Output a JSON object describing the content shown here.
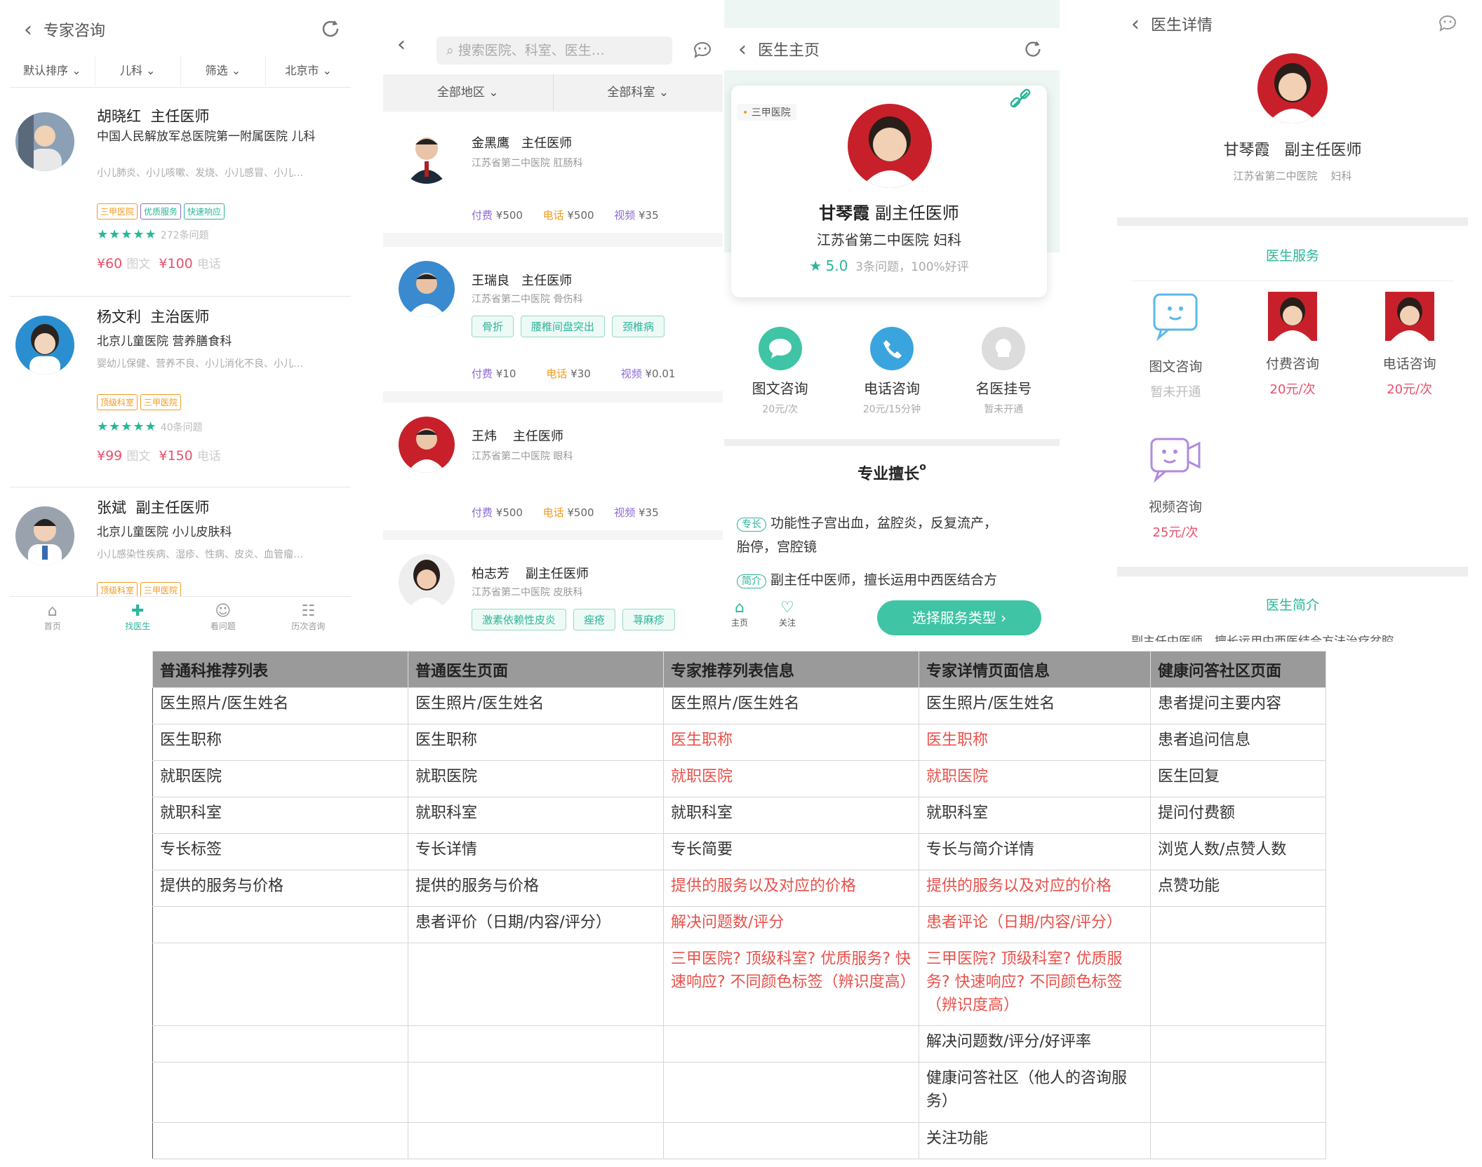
{
  "p1": {
    "title": "专家咨询",
    "filters": [
      "默认排序",
      "儿科",
      "筛选",
      "北京市"
    ],
    "doctors": [
      {
        "name": "胡晓红",
        "rank": "主任医师",
        "hospital": "中国人民解放军总医院第一附属医院 儿科",
        "skills": "小儿肺炎、小儿咳嗽、发烧、小儿感冒、小儿…",
        "tags": [
          "三甲医院",
          "优质服务",
          "快速响应"
        ],
        "count": "272条问题",
        "p1": "¥60",
        "l1": "图文",
        "p2": "¥100",
        "l2": "电话"
      },
      {
        "name": "杨文利",
        "rank": "主治医师",
        "hospital": "北京儿童医院 营养膳食科",
        "skills": "婴幼儿保健、营养不良、小儿消化不良、小儿…",
        "tags": [
          "顶级科室",
          "三甲医院"
        ],
        "count": "40条问题",
        "p1": "¥99",
        "l1": "图文",
        "p2": "¥150",
        "l2": "电话"
      },
      {
        "name": "张斌",
        "rank": "副主任医师",
        "hospital": "北京儿童医院 小儿皮肤科",
        "skills": "小儿感染性疾病、湿疹、性病、皮炎、血管瘤…",
        "tags": [
          "顶级科室",
          "三甲医院"
        ]
      }
    ],
    "nav": [
      "首页",
      "找医生",
      "看问题",
      "历次咨询"
    ]
  },
  "p2": {
    "search": "搜索医院、科室、医生…",
    "filters": [
      "全部地区",
      "全部科室"
    ],
    "doctors": [
      {
        "name": "金黑鹰",
        "rank": "主任医师",
        "hospital": "江苏省第二中医院 肛肠科",
        "pills": [],
        "fee": "¥500",
        "tel": "¥500",
        "video": "¥35"
      },
      {
        "name": "王瑞良",
        "rank": "主任医师",
        "hospital": "江苏省第二中医院 骨伤科",
        "pills": [
          "骨折",
          "腰椎间盘突出",
          "颈椎病"
        ],
        "fee": "¥10",
        "tel": "¥30",
        "video": "¥0.01"
      },
      {
        "name": "王炜",
        "rank": "主任医师",
        "hospital": "江苏省第二中医院 眼科",
        "pills": [],
        "fee": "¥500",
        "tel": "¥500",
        "video": "¥35"
      },
      {
        "name": "柏志芳",
        "rank": "副主任医师",
        "hospital": "江苏省第二中医院 皮肤科",
        "pills": [
          "激素依赖性皮炎",
          "痤疮",
          "荨麻疹"
        ]
      }
    ],
    "fee_label": "付费",
    "tel_label": "电话",
    "video_label": "视频"
  },
  "p3": {
    "title": "医生主页",
    "badge": "三甲医院",
    "name": "甘琴霞",
    "rank": "副主任医师",
    "hospital": "江苏省第二中医院 妇科",
    "score": "5.0",
    "stats": "3条问题，100%好评",
    "services": [
      {
        "name": "图文咨询",
        "price": "20元/次"
      },
      {
        "name": "电话咨询",
        "price": "20元/15分钟"
      },
      {
        "name": "名医挂号",
        "price": "暂未开通"
      }
    ],
    "section": "专业擅长",
    "spec_tag": "专长",
    "spec": "功能性子宫出血，盆腔炎，反复流产，",
    "spec2": "胎停，宫腔镜",
    "intro_tag": "简介",
    "intro": "副主任中医师，擅长运用中西医结合方",
    "nav": [
      "主页",
      "关注"
    ],
    "cta": "选择服务类型"
  },
  "p4": {
    "title": "医生详情",
    "name": "甘琴霞",
    "rank": "副主任医师",
    "hospital": "江苏省第二中医院",
    "dept": "妇科",
    "section1": "医生服务",
    "services": [
      {
        "name": "图文咨询",
        "price": "暂未开通"
      },
      {
        "name": "付费咨询",
        "price": "20元/次"
      },
      {
        "name": "电话咨询",
        "price": "20元/次"
      },
      {
        "name": "视频咨询",
        "price": "25元/次"
      }
    ],
    "section2": "医生简介",
    "intro": "副主任中医师，擅长运用中西医结合方法治疗盆腔"
  },
  "table": {
    "headers": [
      "普通科推荐列表",
      "普通医生页面",
      "专家推荐列表信息",
      "专家详情页面信息",
      "健康问答社区页面"
    ],
    "rows": [
      [
        "医生照片/医生姓名",
        "医生照片/医生姓名",
        "医生照片/医生姓名",
        "医生照片/医生姓名",
        "患者提问主要内容"
      ],
      [
        "医生职称",
        "医生职称",
        "医生职称",
        "医生职称",
        "患者追问信息"
      ],
      [
        "就职医院",
        "就职医院",
        "就职医院",
        "就职医院",
        "医生回复"
      ],
      [
        "就职科室",
        "就职科室",
        "就职科室",
        "就职科室",
        "提问付费额"
      ],
      [
        "专长标签",
        "专长详情",
        "专长简要",
        "专长与简介详情",
        "浏览人数/点赞人数"
      ],
      [
        "提供的服务与价格",
        "提供的服务与价格",
        "提供的服务以及对应的价格",
        "提供的服务以及对应的价格",
        "点赞功能"
      ],
      [
        "",
        "患者评价（日期/内容/评分）",
        "解决问题数/评分",
        "患者评论（日期/内容/评分）",
        ""
      ],
      [
        "",
        "",
        "三甲医院? 顶级科室? 优质服务? 快速响应? 不同颜色标签（辨识度高）",
        "三甲医院? 顶级科室? 优质服务? 快速响应? 不同颜色标签（辨识度高）",
        ""
      ],
      [
        "",
        "",
        "",
        "解决问题数/评分/好评率",
        ""
      ],
      [
        "",
        "",
        "",
        "健康问答社区（他人的咨询服务）",
        ""
      ],
      [
        "",
        "",
        "",
        "关注功能",
        ""
      ]
    ]
  }
}
